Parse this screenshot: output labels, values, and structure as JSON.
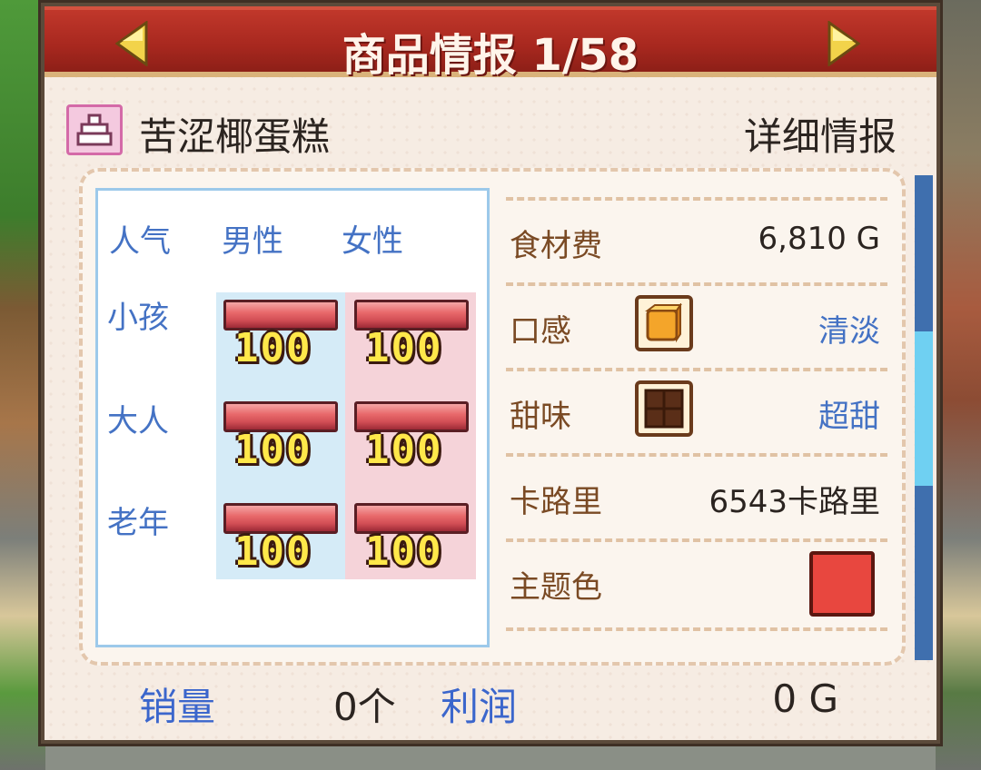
{
  "header": {
    "title": "商品情报 1/58",
    "prev_icon": "triangle-left-icon",
    "next_icon": "triangle-right-icon"
  },
  "product": {
    "icon": "cake-icon",
    "name": "苦涩椰蛋糕",
    "detail_link": "详细情报"
  },
  "popularity": {
    "corner_label": "人气",
    "columns": [
      "男性",
      "女性"
    ],
    "rows": [
      {
        "label": "小孩",
        "male": 100,
        "female": 100
      },
      {
        "label": "大人",
        "male": 100,
        "female": 100
      },
      {
        "label": "老年",
        "male": 100,
        "female": 100
      }
    ]
  },
  "stats": {
    "ingredient_cost": {
      "label": "食材费",
      "value": "6,810 G"
    },
    "texture": {
      "label": "口感",
      "icon": "honey-block-icon",
      "value": "清淡"
    },
    "sweetness": {
      "label": "甜味",
      "icon": "chocolate-block-icon",
      "value": "超甜"
    },
    "calories": {
      "label": "卡路里",
      "value": "6543卡路里"
    },
    "theme_color": {
      "label": "主题色",
      "color": "#e8473f"
    }
  },
  "summary": {
    "sales_label": "销量",
    "sales_value": "0个",
    "profit_label": "利润",
    "profit_value": "0 G"
  },
  "colors": {
    "title_bar": "#a8281f",
    "accent_blue": "#4472c4",
    "label_brown": "#7a4a24",
    "score_yellow": "#ffe84a"
  }
}
